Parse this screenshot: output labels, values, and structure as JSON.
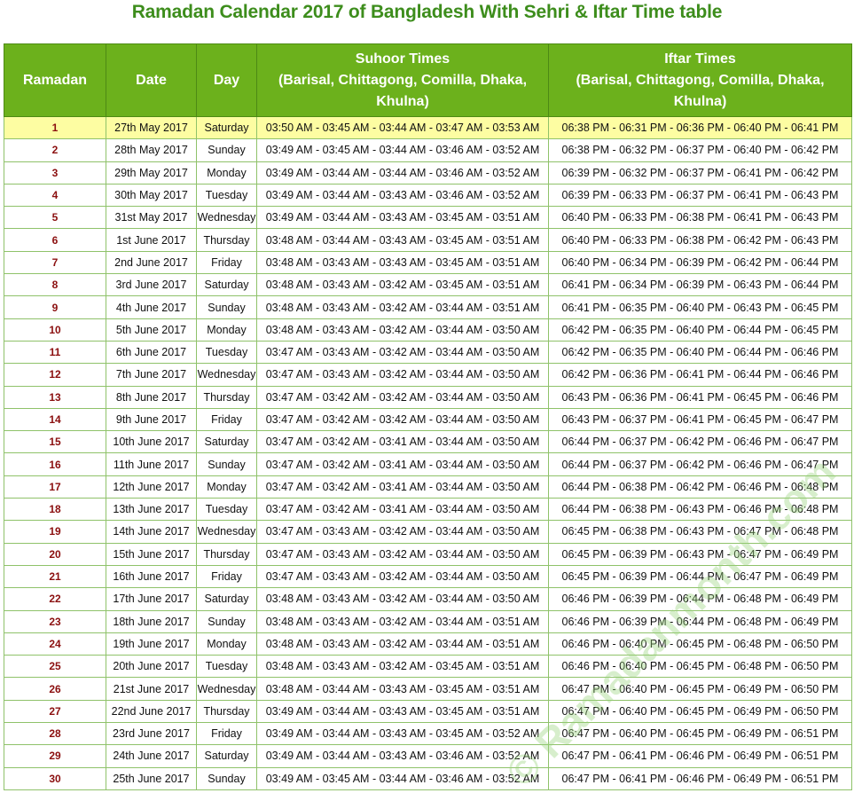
{
  "page": {
    "title": "Ramadan Calendar 2017 of Bangladesh With Sehri & Iftar Time table",
    "watermark": "© Ramadanmonth.com"
  },
  "table": {
    "headers": {
      "ramadan": "Ramadan",
      "date": "Date",
      "day": "Day",
      "suhoor_line1": "Suhoor Times",
      "suhoor_line2": "(Barisal, Chittagong, Comilla, Dhaka, Khulna)",
      "iftar_line1": "Iftar Times",
      "iftar_line2": "(Barisal, Chittagong, Comilla, Dhaka, Khulna)"
    },
    "highlight_color": "#fdfda2",
    "header_color": "#6cb11c",
    "rows": [
      {
        "n": "1",
        "date": "27th May 2017",
        "day": "Saturday",
        "suhoor": "03:50 AM - 03:45 AM - 03:44 AM - 03:47 AM - 03:53 AM",
        "iftar": "06:38 PM - 06:31 PM - 06:36 PM - 06:40 PM - 06:41 PM"
      },
      {
        "n": "2",
        "date": "28th May 2017",
        "day": "Sunday",
        "suhoor": "03:49 AM - 03:45 AM - 03:44 AM - 03:46 AM - 03:52 AM",
        "iftar": "06:38 PM - 06:32 PM - 06:37 PM - 06:40 PM - 06:42 PM"
      },
      {
        "n": "3",
        "date": "29th May 2017",
        "day": "Monday",
        "suhoor": "03:49 AM - 03:44 AM - 03:44 AM - 03:46 AM - 03:52 AM",
        "iftar": "06:39 PM - 06:32 PM - 06:37 PM - 06:41 PM - 06:42 PM"
      },
      {
        "n": "4",
        "date": "30th May 2017",
        "day": "Tuesday",
        "suhoor": "03:49 AM - 03:44 AM - 03:43 AM - 03:46 AM - 03:52 AM",
        "iftar": "06:39 PM - 06:33 PM - 06:37 PM - 06:41 PM - 06:43 PM"
      },
      {
        "n": "5",
        "date": "31st May 2017",
        "day": "Wednesday",
        "suhoor": "03:49 AM - 03:44 AM - 03:43 AM - 03:45 AM - 03:51 AM",
        "iftar": "06:40 PM - 06:33 PM - 06:38 PM - 06:41 PM - 06:43 PM"
      },
      {
        "n": "6",
        "date": "1st June 2017",
        "day": "Thursday",
        "suhoor": "03:48 AM - 03:44 AM - 03:43 AM - 03:45 AM - 03:51 AM",
        "iftar": "06:40 PM - 06:33 PM - 06:38 PM - 06:42 PM - 06:43 PM"
      },
      {
        "n": "7",
        "date": "2nd June 2017",
        "day": "Friday",
        "suhoor": "03:48 AM - 03:43 AM - 03:43 AM - 03:45 AM - 03:51 AM",
        "iftar": "06:40 PM - 06:34 PM - 06:39 PM - 06:42 PM - 06:44 PM"
      },
      {
        "n": "8",
        "date": "3rd June 2017",
        "day": "Saturday",
        "suhoor": "03:48 AM - 03:43 AM - 03:42 AM - 03:45 AM - 03:51 AM",
        "iftar": "06:41 PM - 06:34 PM - 06:39 PM - 06:43 PM - 06:44 PM"
      },
      {
        "n": "9",
        "date": "4th June 2017",
        "day": "Sunday",
        "suhoor": "03:48 AM - 03:43 AM - 03:42 AM - 03:44 AM - 03:51 AM",
        "iftar": "06:41 PM - 06:35 PM - 06:40 PM - 06:43 PM - 06:45 PM"
      },
      {
        "n": "10",
        "date": "5th June 2017",
        "day": "Monday",
        "suhoor": "03:48 AM - 03:43 AM - 03:42 AM - 03:44 AM - 03:50 AM",
        "iftar": "06:42 PM - 06:35 PM - 06:40 PM - 06:44 PM - 06:45 PM"
      },
      {
        "n": "11",
        "date": "6th June 2017",
        "day": "Tuesday",
        "suhoor": "03:47 AM - 03:43 AM - 03:42 AM - 03:44 AM - 03:50 AM",
        "iftar": "06:42 PM - 06:35 PM - 06:40 PM - 06:44 PM - 06:46 PM"
      },
      {
        "n": "12",
        "date": "7th June 2017",
        "day": "Wednesday",
        "suhoor": "03:47 AM - 03:43 AM - 03:42 AM - 03:44 AM - 03:50 AM",
        "iftar": "06:42 PM - 06:36 PM - 06:41 PM - 06:44 PM - 06:46 PM"
      },
      {
        "n": "13",
        "date": "8th June 2017",
        "day": "Thursday",
        "suhoor": "03:47 AM - 03:42 AM - 03:42 AM - 03:44 AM - 03:50 AM",
        "iftar": "06:43 PM - 06:36 PM - 06:41 PM - 06:45 PM - 06:46 PM"
      },
      {
        "n": "14",
        "date": "9th June 2017",
        "day": "Friday",
        "suhoor": "03:47 AM - 03:42 AM - 03:42 AM - 03:44 AM - 03:50 AM",
        "iftar": "06:43 PM - 06:37 PM - 06:41 PM - 06:45 PM - 06:47 PM"
      },
      {
        "n": "15",
        "date": "10th June 2017",
        "day": "Saturday",
        "suhoor": "03:47 AM - 03:42 AM - 03:41 AM - 03:44 AM - 03:50 AM",
        "iftar": "06:44 PM - 06:37 PM - 06:42 PM - 06:46 PM - 06:47 PM"
      },
      {
        "n": "16",
        "date": "11th June 2017",
        "day": "Sunday",
        "suhoor": "03:47 AM - 03:42 AM - 03:41 AM - 03:44 AM - 03:50 AM",
        "iftar": "06:44 PM - 06:37 PM - 06:42 PM - 06:46 PM - 06:47 PM"
      },
      {
        "n": "17",
        "date": "12th June 2017",
        "day": "Monday",
        "suhoor": "03:47 AM - 03:42 AM - 03:41 AM - 03:44 AM - 03:50 AM",
        "iftar": "06:44 PM - 06:38 PM - 06:42 PM - 06:46 PM - 06:48 PM"
      },
      {
        "n": "18",
        "date": "13th June 2017",
        "day": "Tuesday",
        "suhoor": "03:47 AM - 03:42 AM - 03:41 AM - 03:44 AM - 03:50 AM",
        "iftar": "06:44 PM - 06:38 PM - 06:43 PM - 06:46 PM - 06:48 PM"
      },
      {
        "n": "19",
        "date": "14th June 2017",
        "day": "Wednesday",
        "suhoor": "03:47 AM - 03:43 AM - 03:42 AM - 03:44 AM - 03:50 AM",
        "iftar": "06:45 PM - 06:38 PM - 06:43 PM - 06:47 PM - 06:48 PM"
      },
      {
        "n": "20",
        "date": "15th June 2017",
        "day": "Thursday",
        "suhoor": "03:47 AM - 03:43 AM - 03:42 AM - 03:44 AM - 03:50 AM",
        "iftar": "06:45 PM - 06:39 PM - 06:43 PM - 06:47 PM - 06:49 PM"
      },
      {
        "n": "21",
        "date": "16th June 2017",
        "day": "Friday",
        "suhoor": "03:47 AM - 03:43 AM - 03:42 AM - 03:44 AM - 03:50 AM",
        "iftar": "06:45 PM - 06:39 PM - 06:44 PM - 06:47 PM - 06:49 PM"
      },
      {
        "n": "22",
        "date": "17th June 2017",
        "day": "Saturday",
        "suhoor": "03:48 AM - 03:43 AM - 03:42 AM - 03:44 AM - 03:50 AM",
        "iftar": "06:46 PM - 06:39 PM - 06:44 PM - 06:48 PM - 06:49 PM"
      },
      {
        "n": "23",
        "date": "18th June 2017",
        "day": "Sunday",
        "suhoor": "03:48 AM - 03:43 AM - 03:42 AM - 03:44 AM - 03:51 AM",
        "iftar": "06:46 PM - 06:39 PM - 06:44 PM - 06:48 PM - 06:49 PM"
      },
      {
        "n": "24",
        "date": "19th June 2017",
        "day": "Monday",
        "suhoor": "03:48 AM - 03:43 AM - 03:42 AM - 03:44 AM - 03:51 AM",
        "iftar": "06:46 PM - 06:40 PM - 06:45 PM - 06:48 PM - 06:50 PM"
      },
      {
        "n": "25",
        "date": "20th June 2017",
        "day": "Tuesday",
        "suhoor": "03:48 AM - 03:43 AM - 03:42 AM - 03:45 AM - 03:51 AM",
        "iftar": "06:46 PM - 06:40 PM - 06:45 PM - 06:48 PM - 06:50 PM"
      },
      {
        "n": "26",
        "date": "21st June 2017",
        "day": "Wednesday",
        "suhoor": "03:48 AM - 03:44 AM - 03:43 AM - 03:45 AM - 03:51 AM",
        "iftar": "06:47 PM - 06:40 PM - 06:45 PM - 06:49 PM - 06:50 PM"
      },
      {
        "n": "27",
        "date": "22nd June 2017",
        "day": "Thursday",
        "suhoor": "03:49 AM - 03:44 AM - 03:43 AM - 03:45 AM - 03:51 AM",
        "iftar": "06:47 PM - 06:40 PM - 06:45 PM - 06:49 PM - 06:50 PM"
      },
      {
        "n": "28",
        "date": "23rd June 2017",
        "day": "Friday",
        "suhoor": "03:49 AM - 03:44 AM - 03:43 AM - 03:45 AM - 03:52 AM",
        "iftar": "06:47 PM - 06:40 PM - 06:45 PM - 06:49 PM - 06:51 PM"
      },
      {
        "n": "29",
        "date": "24th June 2017",
        "day": "Saturday",
        "suhoor": "03:49 AM - 03:44 AM - 03:43 AM - 03:46 AM - 03:52 AM",
        "iftar": "06:47 PM - 06:41 PM - 06:46 PM - 06:49 PM - 06:51 PM"
      },
      {
        "n": "30",
        "date": "25th June 2017",
        "day": "Sunday",
        "suhoor": "03:49 AM - 03:45 AM - 03:44 AM - 03:46 AM - 03:52 AM",
        "iftar": "06:47 PM - 06:41 PM - 06:46 PM - 06:49 PM - 06:51 PM"
      }
    ]
  }
}
